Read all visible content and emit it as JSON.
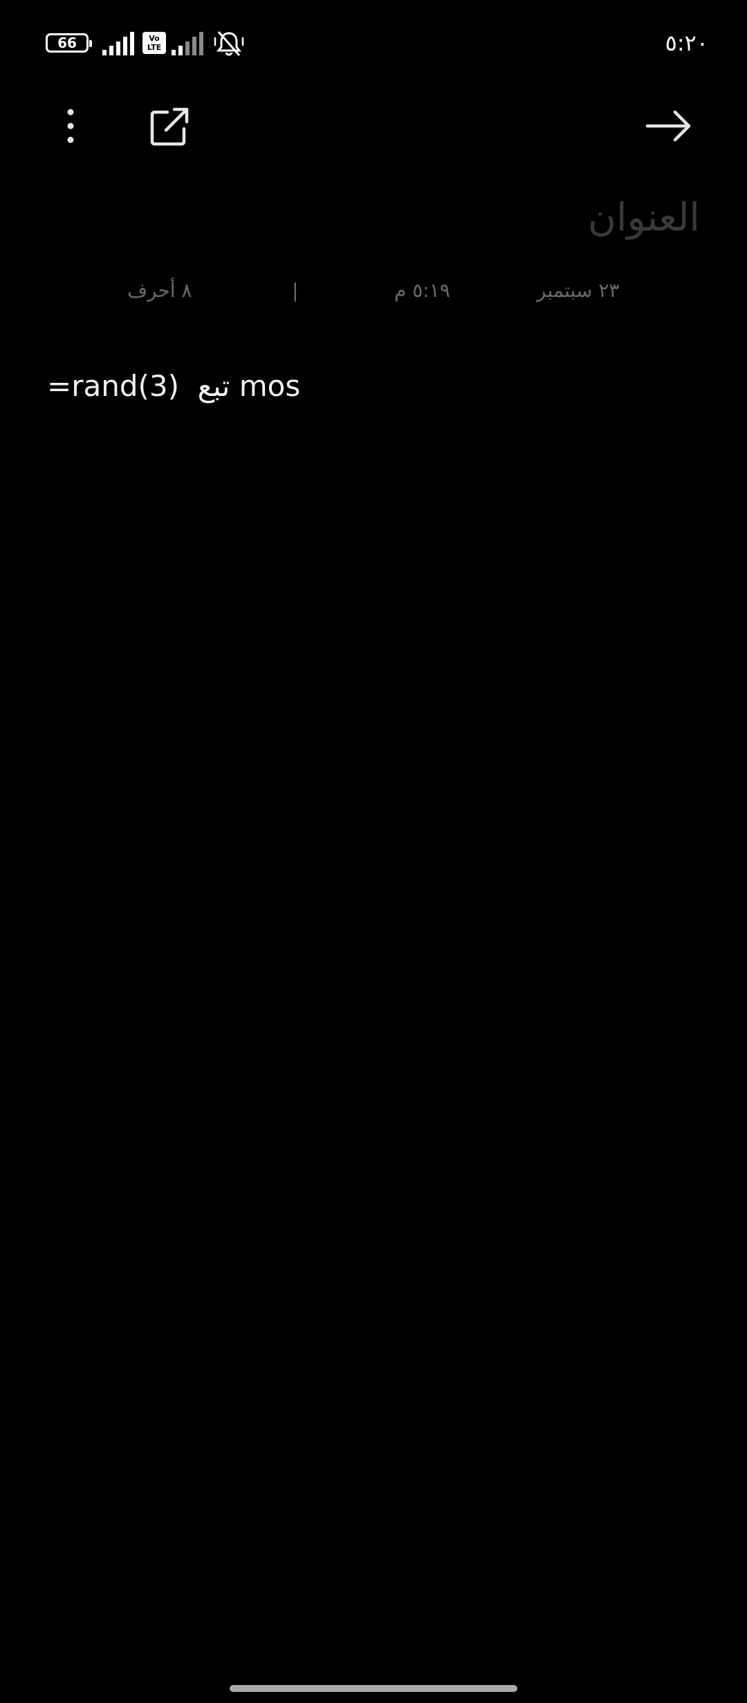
{
  "status_bar": {
    "battery_level": "66",
    "volte_label_top": "Vo",
    "volte_label_bottom": "LTE",
    "clock": "٥:٢٠",
    "icons": [
      "battery-icon",
      "signal-icon",
      "volte-icon",
      "signal-icon",
      "mute-icon"
    ]
  },
  "toolbar": {
    "icons": [
      "more-vertical-icon",
      "share-icon",
      "arrow-right-icon"
    ]
  },
  "note": {
    "title_placeholder": "العنوان",
    "date": "٢٣ سبتمبر",
    "time": "٥:١٩ م",
    "separator": "|",
    "char_count": "٨ أحرف",
    "body": "=rand(3)  تبع mos"
  },
  "colors": {
    "background": "#000000",
    "text": "#f2f2f2",
    "placeholder": "#3a3a3a",
    "meta": "#6a6a6a",
    "home_indicator": "#a9a9a9"
  }
}
